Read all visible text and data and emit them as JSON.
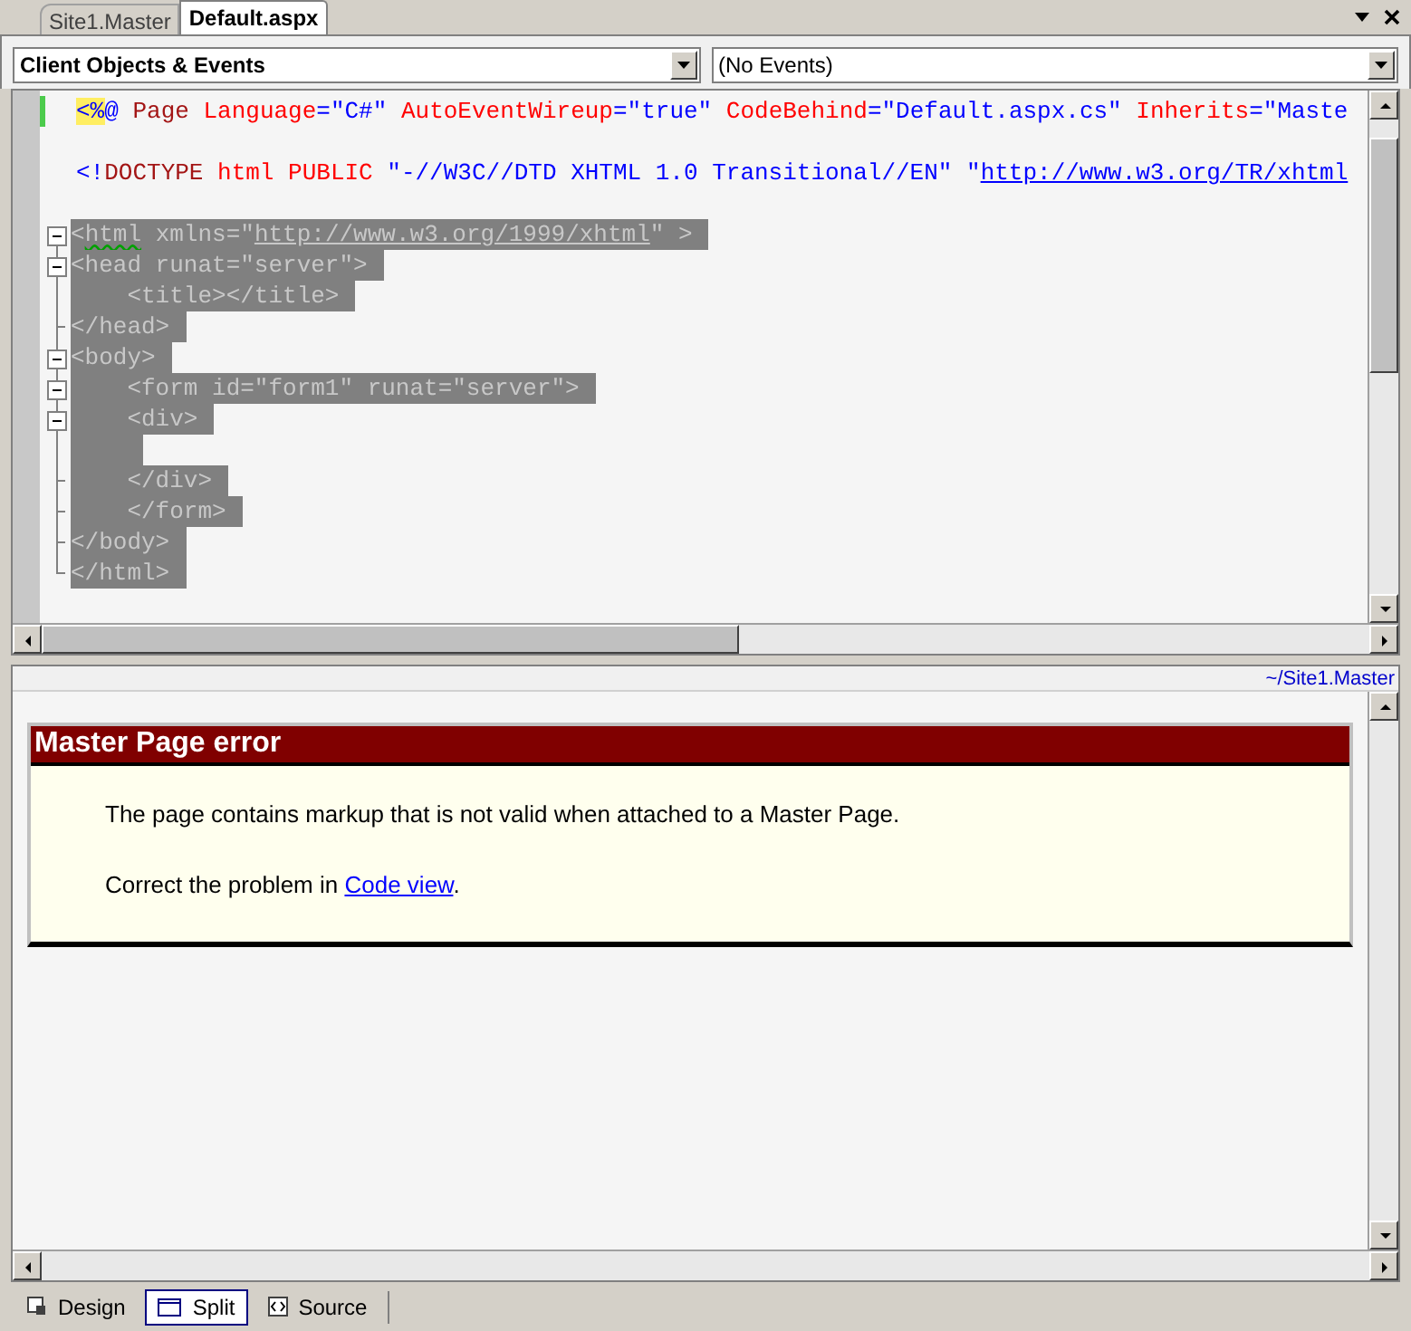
{
  "tabs": [
    {
      "label": "Site1.Master",
      "selected": false
    },
    {
      "label": "Default.aspx",
      "selected": true
    }
  ],
  "dropdowns": [
    {
      "value": "Client Objects & Events",
      "bold": true
    },
    {
      "value": "(No Events)",
      "bold": false
    }
  ],
  "code_lines": [
    {
      "selected": false,
      "modified": true,
      "tokens": [
        {
          "text": "<%",
          "kind": "marker"
        },
        {
          "text": "@ ",
          "kind": "delim"
        },
        {
          "text": "Page ",
          "kind": "tag"
        },
        {
          "text": "Language",
          "kind": "attr"
        },
        {
          "text": "=\"C#\" ",
          "kind": "value"
        },
        {
          "text": "AutoEventWireup",
          "kind": "attr"
        },
        {
          "text": "=\"true\" ",
          "kind": "value"
        },
        {
          "text": "CodeBehind",
          "kind": "attr"
        },
        {
          "text": "=\"Default.aspx.cs\" ",
          "kind": "value"
        },
        {
          "text": "Inherits",
          "kind": "attr"
        },
        {
          "text": "=\"Maste",
          "kind": "value"
        }
      ]
    },
    {
      "selected": false,
      "modified": false
    },
    {
      "selected": false,
      "modified": false,
      "tokens": [
        {
          "text": "<!",
          "kind": "delim"
        },
        {
          "text": "DOCTYPE ",
          "kind": "tag"
        },
        {
          "text": "html PUBLIC ",
          "kind": "attr"
        },
        {
          "text": "\"-//W3C//DTD XHTML 1.0 Transitional//EN\" \"",
          "kind": "value"
        },
        {
          "text": "http://www.w3.org/TR/xhtml",
          "kind": "url"
        }
      ]
    },
    {
      "selected": false,
      "modified": false
    },
    {
      "selected": true,
      "modified": false,
      "collapsible": true,
      "block_end": false,
      "tokens": [
        {
          "text": "<",
          "kind": "delim"
        },
        {
          "text": "html",
          "kind": "error"
        },
        {
          "text": " xmlns=\"",
          "kind": "attr"
        },
        {
          "text": "http://www.w3.org/1999/xhtml",
          "kind": "url"
        },
        {
          "text": "\" >",
          "kind": "value"
        }
      ]
    },
    {
      "selected": true,
      "modified": false,
      "collapsible": true,
      "block_end": false,
      "tokens": [
        {
          "text": "<head runat=\"server\">",
          "kind": "plain"
        }
      ]
    },
    {
      "selected": true,
      "modified": false,
      "collapsible": false,
      "block_end": false,
      "tokens": [
        {
          "text": "    <title></title>",
          "kind": "plain"
        }
      ]
    },
    {
      "selected": true,
      "modified": false,
      "collapsible": false,
      "block_end": true,
      "tokens": [
        {
          "text": "</head>",
          "kind": "plain"
        }
      ]
    },
    {
      "selected": true,
      "modified": false,
      "collapsible": true,
      "block_end": false,
      "tokens": [
        {
          "text": "<body>",
          "kind": "plain"
        }
      ]
    },
    {
      "selected": true,
      "modified": false,
      "collapsible": true,
      "block_end": false,
      "tokens": [
        {
          "text": "    <form id=\"form1\" runat=\"server\">",
          "kind": "plain"
        }
      ]
    },
    {
      "selected": true,
      "modified": false,
      "collapsible": true,
      "block_end": false,
      "tokens": [
        {
          "text": "    <div>",
          "kind": "plain"
        }
      ]
    },
    {
      "selected": true,
      "modified": false,
      "collapsible": false,
      "block_end": false
    },
    {
      "selected": true,
      "modified": false,
      "collapsible": false,
      "block_end": true,
      "tokens": [
        {
          "text": "    </div>",
          "kind": "plain"
        }
      ]
    },
    {
      "selected": true,
      "modified": false,
      "collapsible": false,
      "block_end": true,
      "tokens": [
        {
          "text": "    </form>",
          "kind": "plain"
        }
      ]
    },
    {
      "selected": true,
      "modified": false,
      "collapsible": false,
      "block_end": true,
      "tokens": [
        {
          "text": "</body>",
          "kind": "plain"
        }
      ]
    },
    {
      "selected": true,
      "modified": false,
      "collapsible": false,
      "block_end": true,
      "tokens": [
        {
          "text": "</html>",
          "kind": "plain"
        }
      ]
    }
  ],
  "design_pane": {
    "master_path": "~/Site1.Master",
    "error": {
      "title": "Master Page error",
      "message": "The page contains markup that is not valid when attached to a Master Page.",
      "fix_prefix": "Correct the problem in ",
      "fix_link": "Code view",
      "fix_suffix": "."
    }
  },
  "view_tabs": [
    {
      "label": "Design",
      "kind": "design",
      "selected": false
    },
    {
      "label": "Split",
      "kind": "split",
      "selected": true
    },
    {
      "label": "Source",
      "kind": "source",
      "selected": false
    }
  ]
}
